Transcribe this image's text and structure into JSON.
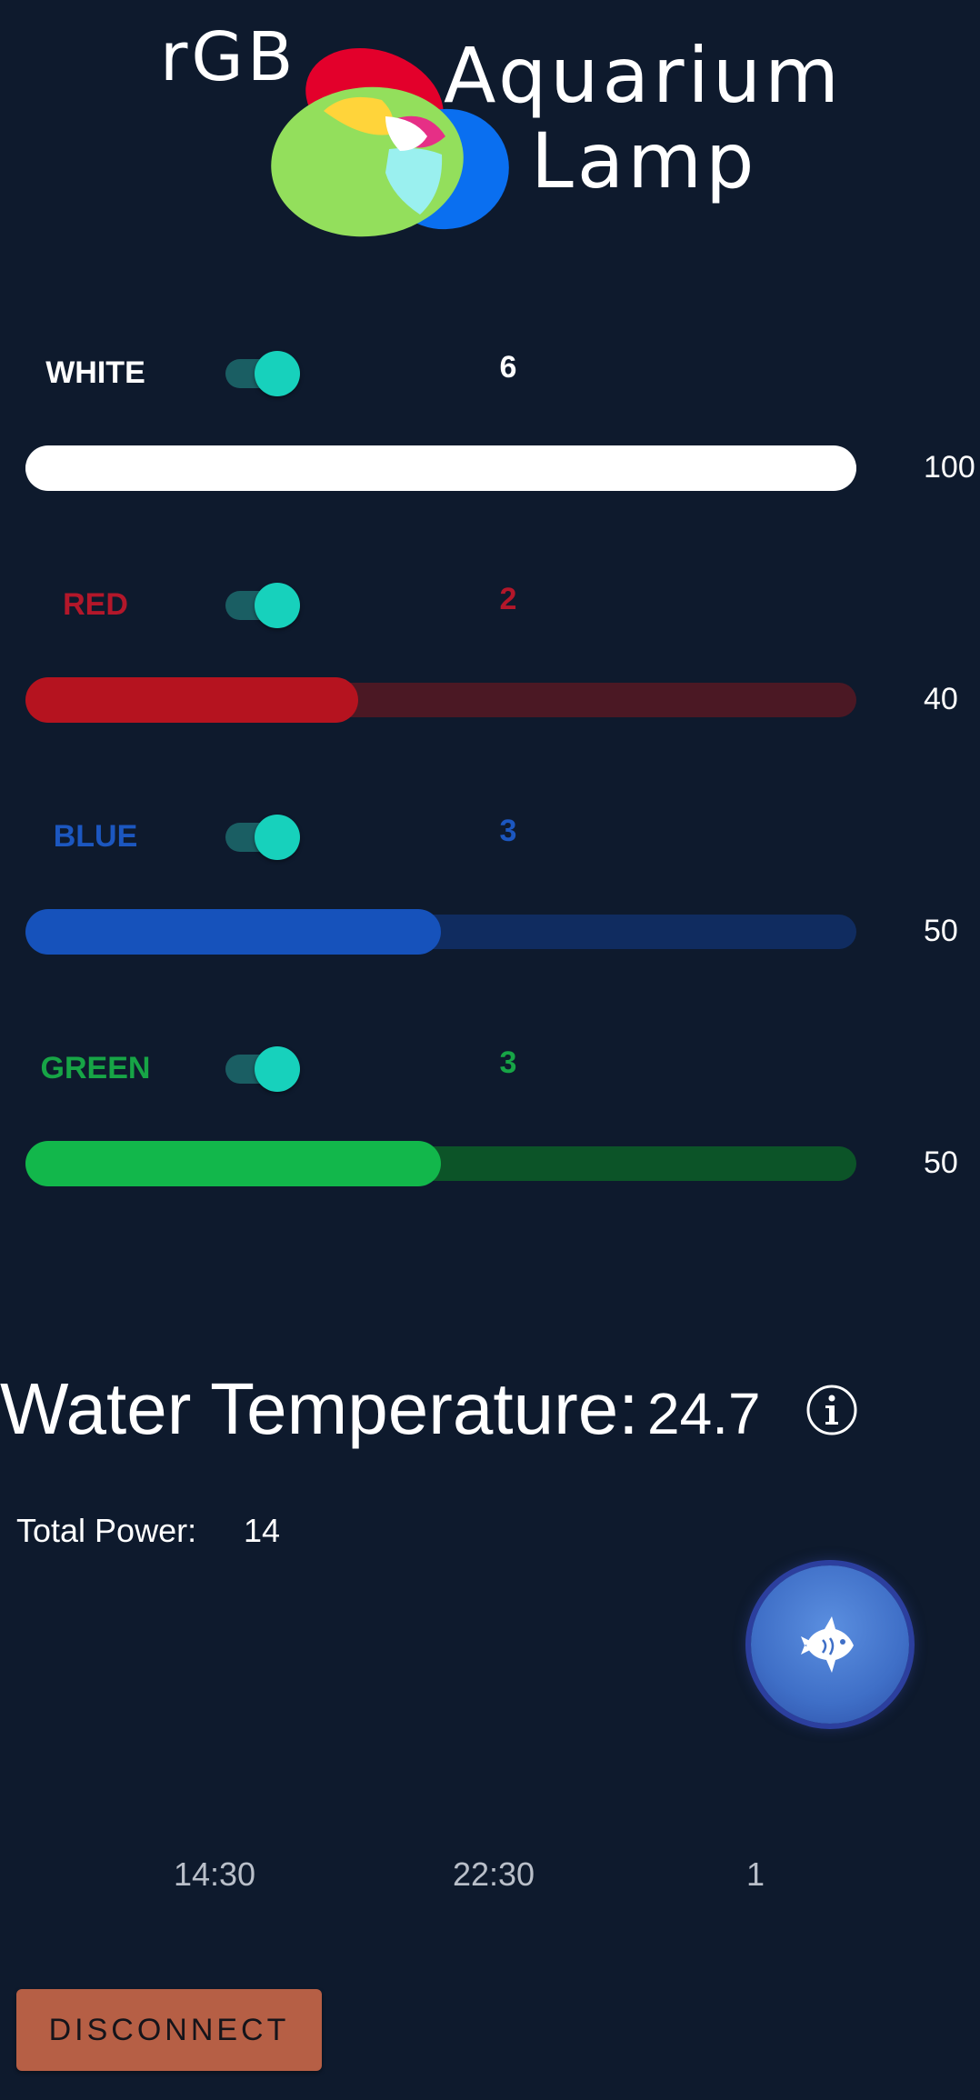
{
  "logo": {
    "line1": "rGB",
    "line2": "Aquarium",
    "line3": "Lamp"
  },
  "channels": [
    {
      "label": "WHITE",
      "level": "6",
      "value": "100",
      "percent": 100,
      "enabled": true,
      "label_color": "#ffffff",
      "fill_color": "#ffffff",
      "track_color": "#ffffff"
    },
    {
      "label": "RED",
      "level": "2",
      "value": "40",
      "percent": 40,
      "enabled": true,
      "label_color": "#b3172a",
      "fill_color": "#b5131f",
      "track_color": "#4b1824"
    },
    {
      "label": "BLUE",
      "level": "3",
      "value": "50",
      "percent": 50,
      "enabled": true,
      "label_color": "#1c57c0",
      "fill_color": "#1652bb",
      "track_color": "#102c60"
    },
    {
      "label": "GREEN",
      "level": "3",
      "value": "50",
      "percent": 50,
      "enabled": true,
      "label_color": "#17a546",
      "fill_color": "#12b74b",
      "track_color": "#0c5428"
    }
  ],
  "temperature": {
    "label": "Water Temperature:",
    "value": "24.7"
  },
  "power": {
    "label": "Total Power:",
    "value": "14"
  },
  "times": [
    "14:30",
    "22:30",
    "1"
  ],
  "icons": {
    "info": "info-icon",
    "fish": "fish-icon"
  },
  "disconnect_label": "DISCONNECT",
  "colors": {
    "background": "#0e1a2d",
    "toggle_thumb": "#17d1bc",
    "toggle_track": "#1a5e63",
    "fab": "#3f6fc7",
    "disconnect": "#b65f45"
  }
}
